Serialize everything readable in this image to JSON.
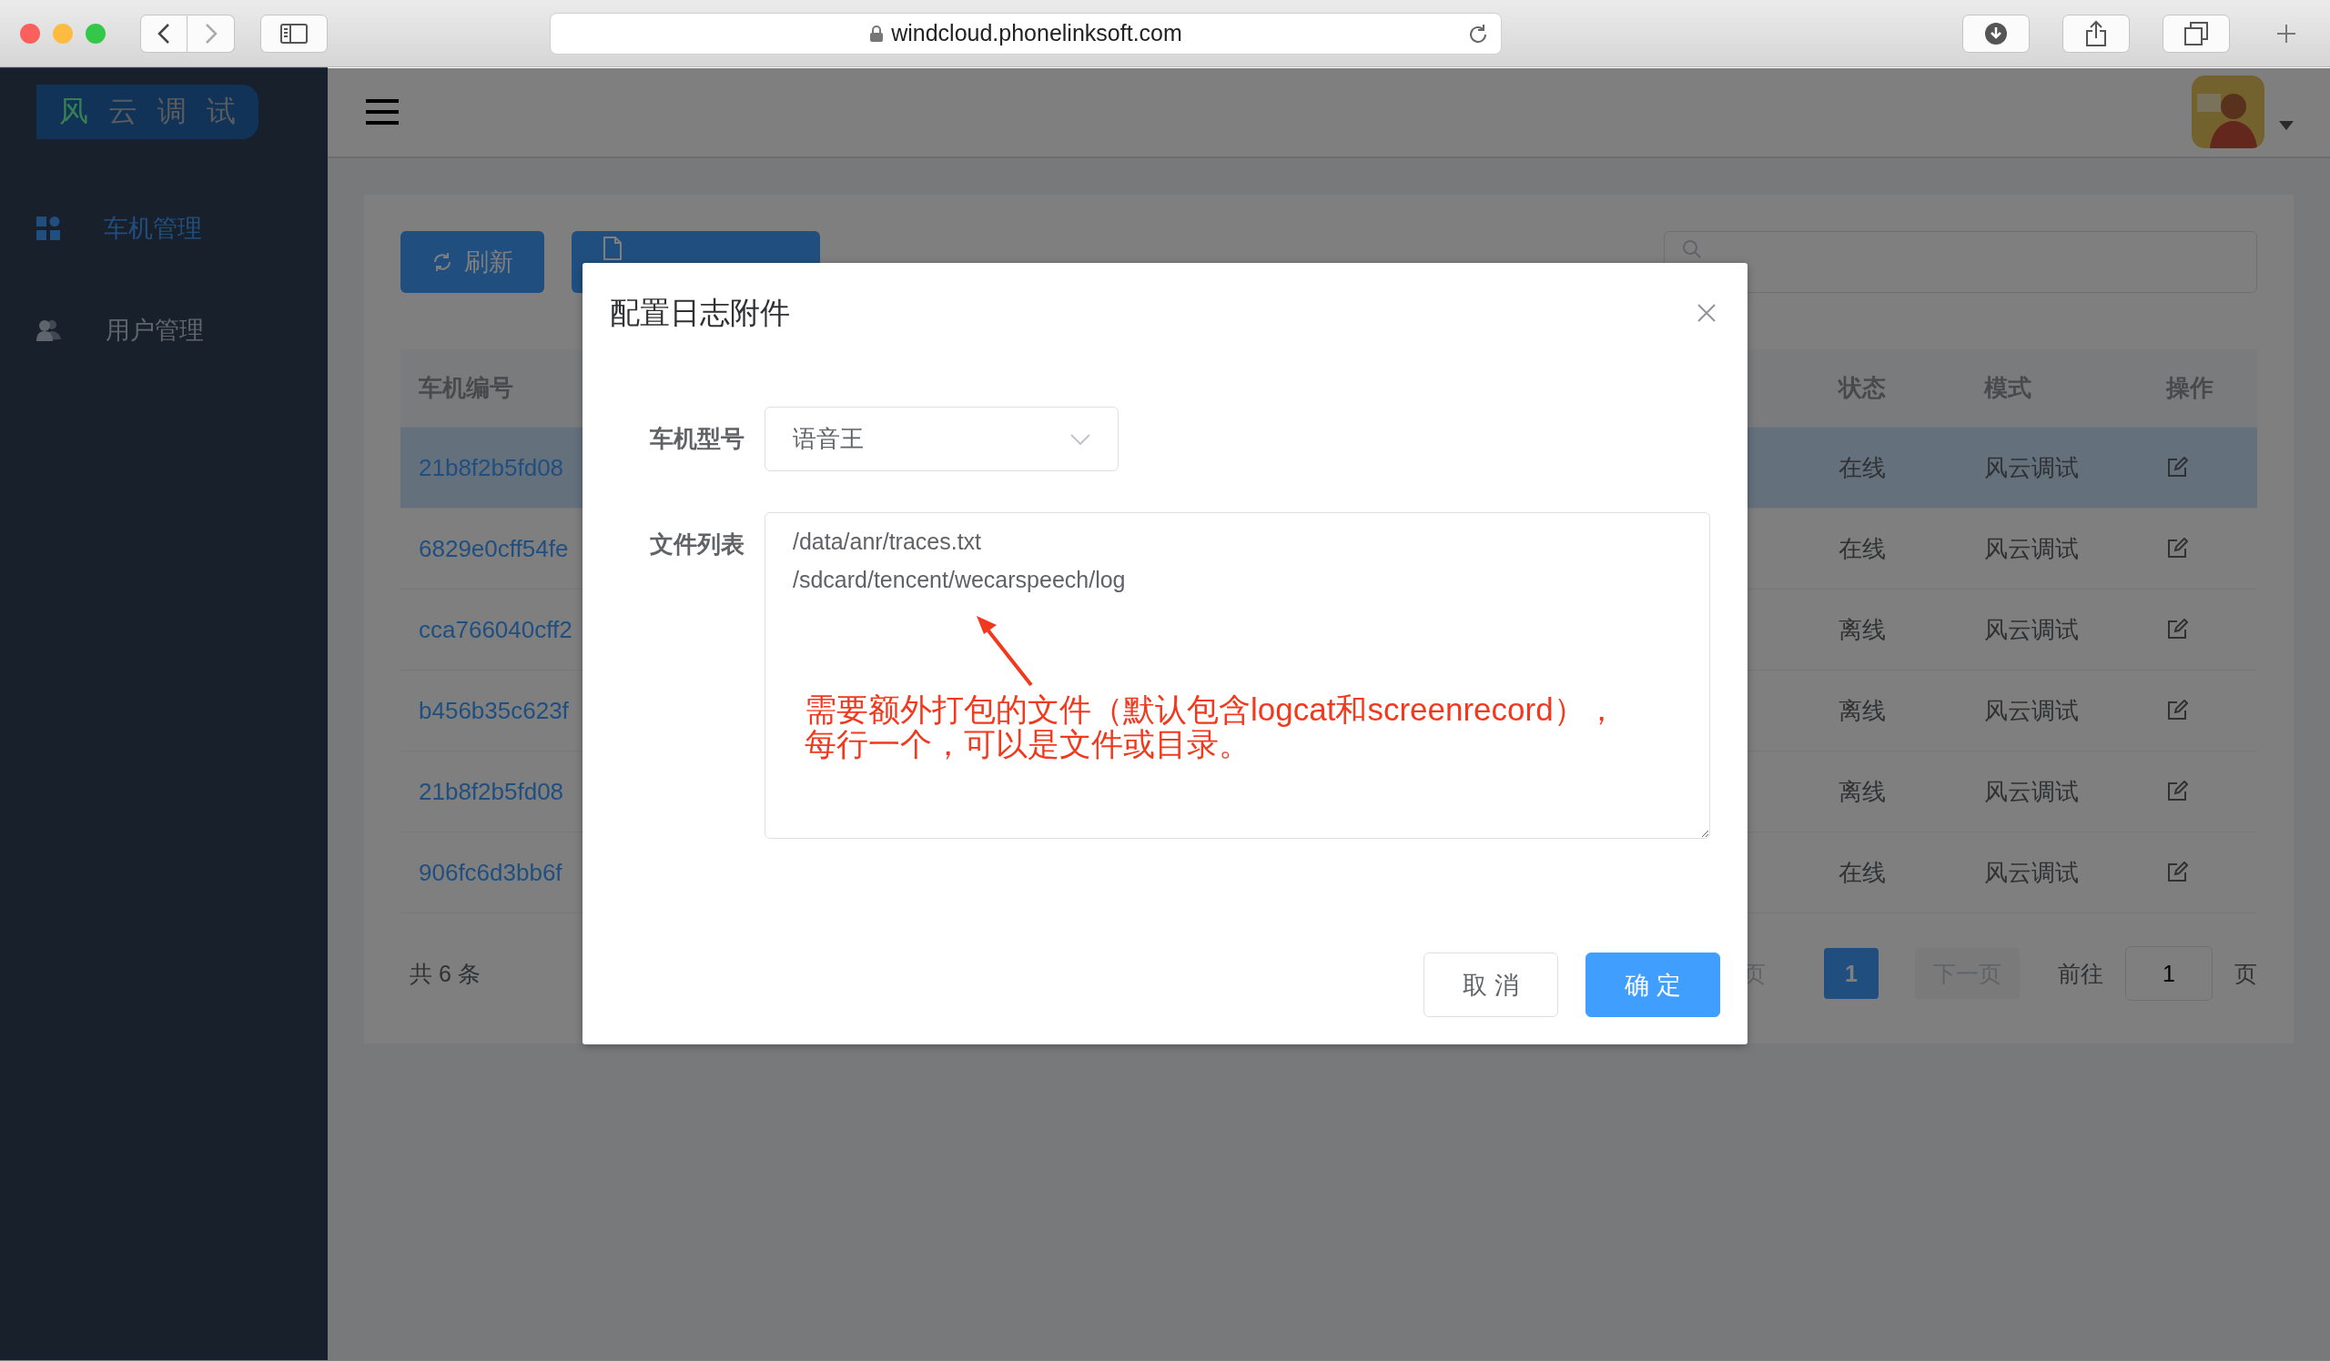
{
  "browser": {
    "url": "windcloud.phonelinksoft.com"
  },
  "sidebar": {
    "logo": [
      "风",
      "云",
      "调",
      "试"
    ],
    "items": [
      {
        "label": "车机管理",
        "selected": true
      },
      {
        "label": "用户管理",
        "selected": false
      }
    ]
  },
  "toolbar": {
    "buttons": [
      {
        "label": "刷新"
      }
    ]
  },
  "table": {
    "columns": [
      "车机编号",
      "状态",
      "模式",
      "操作"
    ],
    "rows": [
      {
        "id": "21b8f2b5fd08",
        "status": "在线",
        "mode": "风云调试",
        "selected": true
      },
      {
        "id": "6829e0cff54fe",
        "status": "在线",
        "mode": "风云调试",
        "selected": false
      },
      {
        "id": "cca766040cff2",
        "status": "离线",
        "mode": "风云调试",
        "selected": false
      },
      {
        "id": "b456b35c623f",
        "status": "离线",
        "mode": "风云调试",
        "selected": false
      },
      {
        "id": "21b8f2b5fd08",
        "status": "离线",
        "mode": "风云调试",
        "selected": false
      },
      {
        "id": "906fc6d3bb6f",
        "status": "在线",
        "mode": "风云调试",
        "selected": false
      }
    ]
  },
  "footer": {
    "total": "共 6 条",
    "prev": "页",
    "pages": [
      {
        "label": "1",
        "selected": true
      }
    ],
    "next": "下一页",
    "goto_label": "前往",
    "goto_value": "1",
    "goto_suffix": "页"
  },
  "dialog": {
    "title": "配置日志附件",
    "fields": [
      {
        "kind": "select",
        "label": "车机型号",
        "value": "语音王"
      },
      {
        "kind": "textarea",
        "label": "文件列表",
        "lines": [
          "/data/anr/traces.txt",
          "/sdcard/tencent/wecarspeech/log"
        ]
      }
    ],
    "buttons": [
      {
        "label": "取 消",
        "kind": "default"
      },
      {
        "label": "确 定",
        "kind": "primary"
      }
    ]
  },
  "annotation": {
    "lines": [
      "需要额外打包的文件（默认包含logcat和screenrecord），",
      "每行一个，可以是文件或目录。"
    ]
  }
}
